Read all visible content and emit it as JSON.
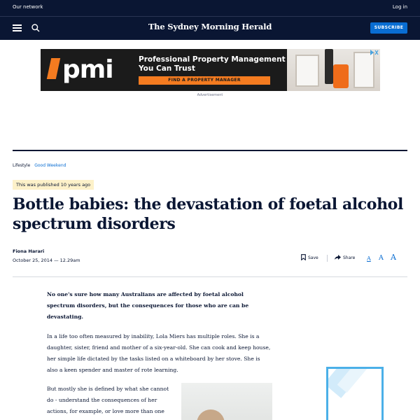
{
  "topbar": {
    "network_label": "Our network",
    "login_label": "Log in"
  },
  "nav": {
    "masthead": "The Sydney Morning Herald",
    "subscribe_label": "SUBSCRIBE"
  },
  "ad": {
    "brand": "pmi",
    "headline": "Professional Property Management You Can Trust",
    "cta": "FIND A PROPERTY MANAGER",
    "label": "Advertisement"
  },
  "breadcrumb": {
    "section": "Lifestyle",
    "subsection": "Good Weekend"
  },
  "published_notice": "This was published 10 years ago",
  "article": {
    "title": "Bottle babies: the devastation of foetal alcohol spectrum disorders",
    "author": "Fiona Harari",
    "date": "October 25, 2014 — 12.29am",
    "tools": {
      "save_label": "Save",
      "share_label": "Share",
      "font_sizes": [
        "A",
        "A",
        "A"
      ]
    },
    "lead": "No one's sure how many Australians are affected by foetal alcohol spectrum disorders, but the consequences for those who are can be devastating.",
    "paragraph_2": "In a life too often measured by inability, Lola Miers has multiple roles. She is a daughter, sister, friend and mother of a six-year-old. She can cook and keep house, her simple life dictated by the tasks listed on a whiteboard by her stove. She is also a keen spender and master of rote learning.",
    "paragraph_3": "But mostly she is defined by what she cannot do - understand the consequences of her actions, for example, or love more than one"
  },
  "colors": {
    "navy": "#0a1633",
    "accent_blue": "#096dd2",
    "ad_orange": "#f47b20",
    "notice_bg": "#fdf1c9"
  }
}
